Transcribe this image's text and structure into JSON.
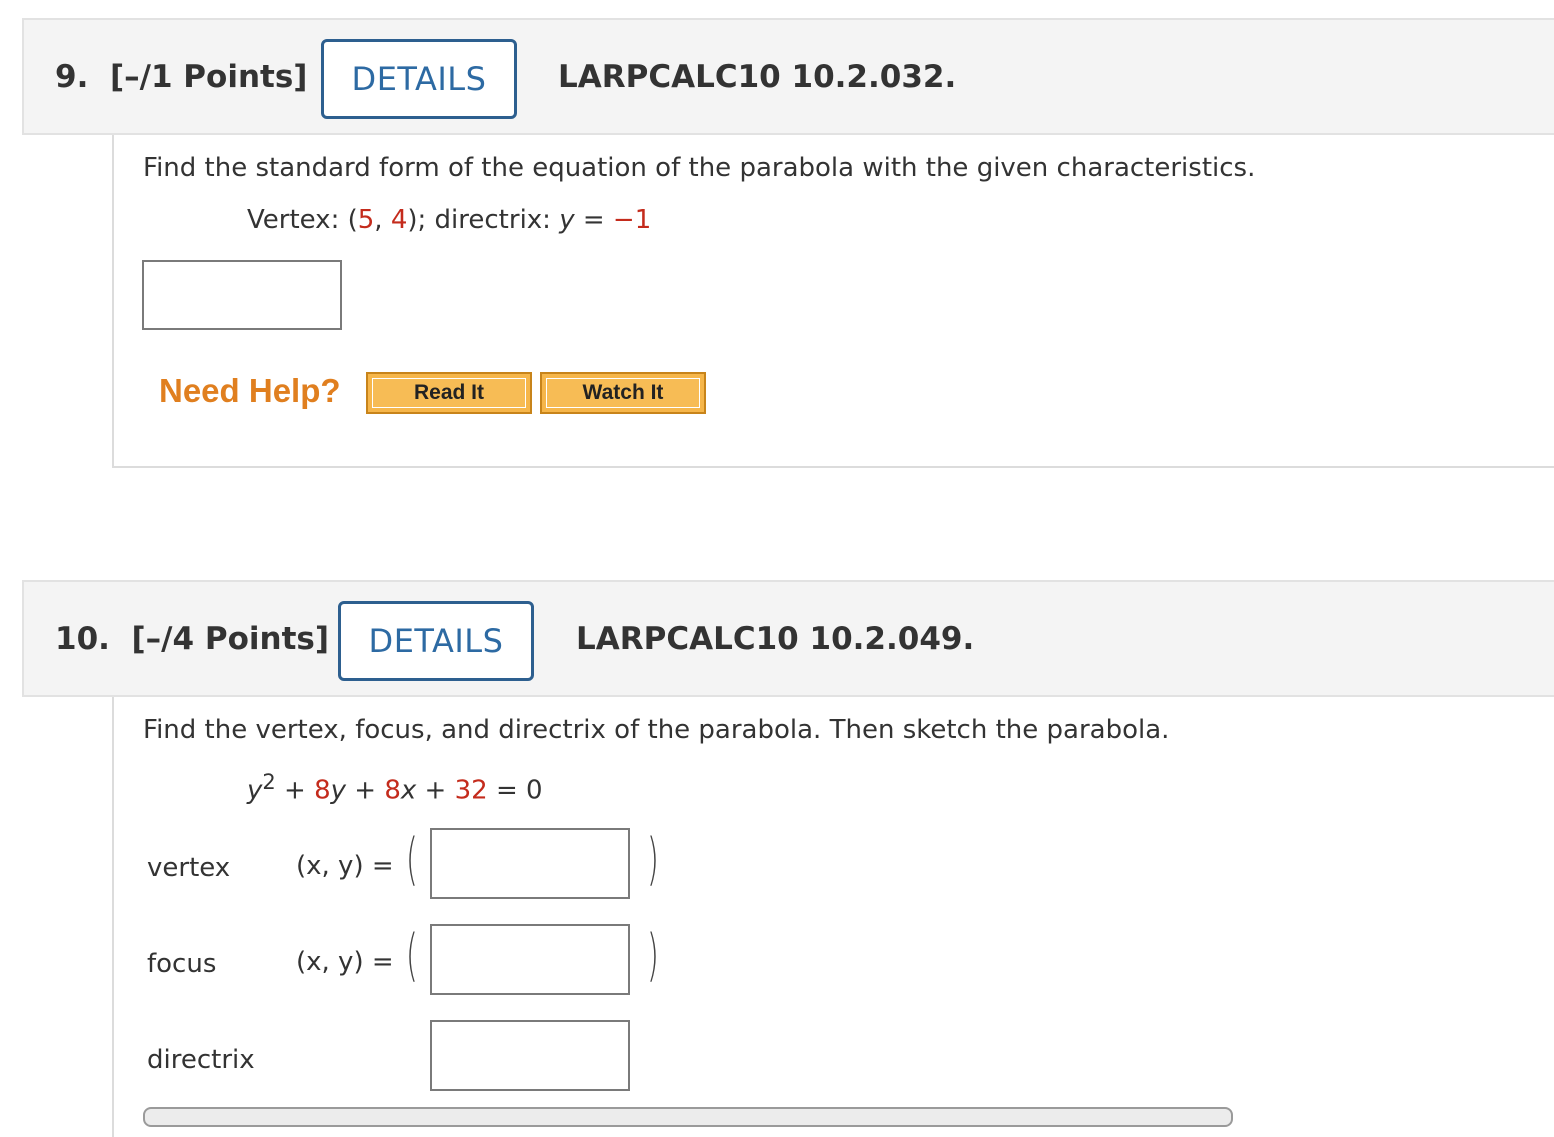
{
  "q9": {
    "number": "9.",
    "points": "[–/1 Points]",
    "details_label": "DETAILS",
    "code": "LARPCALC10 10.2.032.",
    "prompt": "Find the standard form of the equation of the parabola with the given characteristics.",
    "given": {
      "vertex_label": "Vertex: (",
      "vertex_x": "5",
      "vertex_sep": ", ",
      "vertex_y": "4",
      "after_vertex": "); directrix: ",
      "dir_var": "y",
      "dir_eq": " = ",
      "dir_val": "−1"
    },
    "answer_value": "",
    "need_help": "Need Help?",
    "read_it": "Read It",
    "watch_it": "Watch It"
  },
  "q10": {
    "number": "10.",
    "points": "[–/4 Points]",
    "details_label": "DETAILS",
    "code": "LARPCALC10 10.2.049.",
    "prompt": "Find the vertex, focus, and directrix of the parabola. Then sketch the parabola.",
    "equation": {
      "y": "y",
      "exp": "2",
      "plus1": " + ",
      "coef1": "8",
      "v1": "y",
      "plus2": " + ",
      "coef2": "8",
      "v2": "x",
      "plus3": " + ",
      "const": "32",
      "eq": " = 0"
    },
    "vertex_label": "vertex",
    "focus_label": "focus",
    "directrix_label": "directrix",
    "xy_label": "(x, y) =",
    "paren_open": "(",
    "paren_close": ")",
    "vertex_value": "",
    "focus_value": "",
    "directrix_value": ""
  },
  "colors": {
    "details_border": "#2d5f8f",
    "math_red": "#c42b1c",
    "need_help": "#e07f1f",
    "help_button": "#f6b64a"
  }
}
